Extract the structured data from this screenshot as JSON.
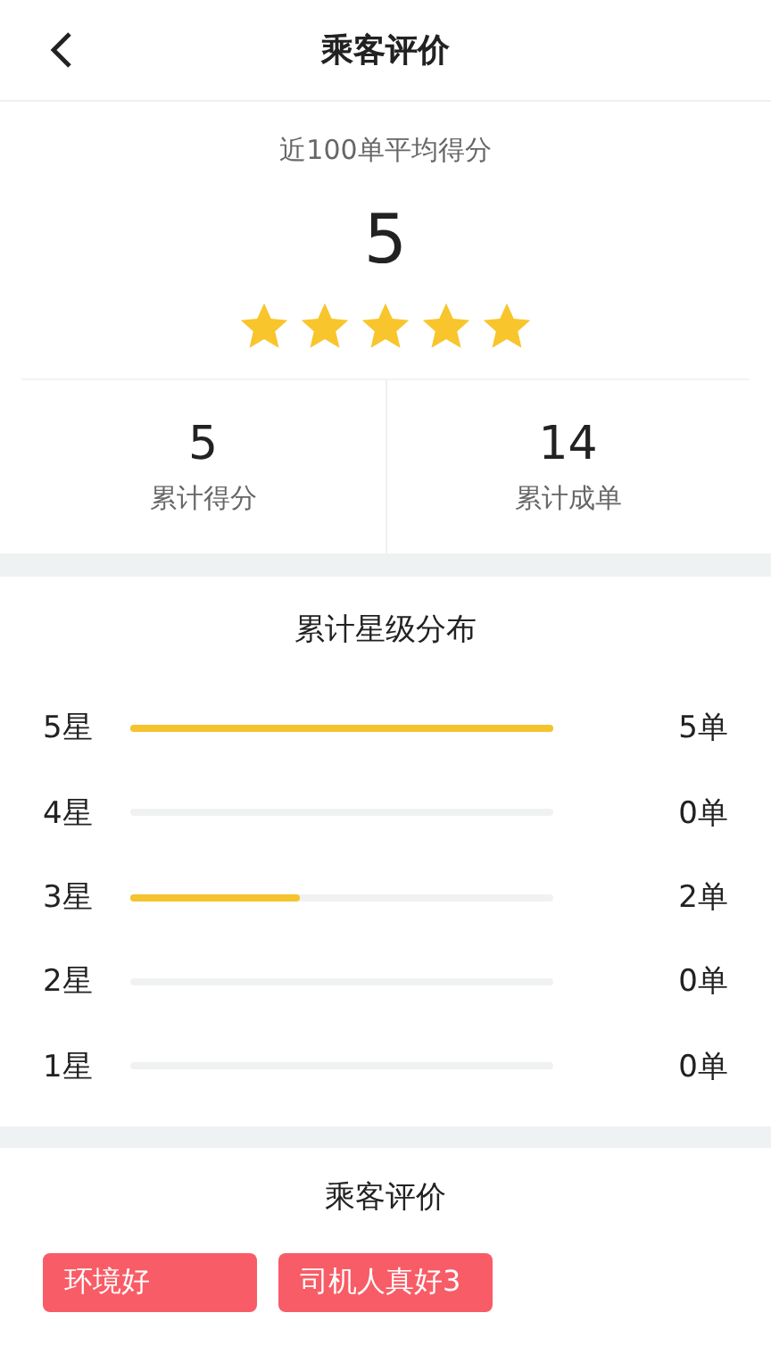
{
  "header": {
    "title": "乘客评价"
  },
  "summary": {
    "caption": "近100单平均得分",
    "score": "5",
    "stars": 5,
    "stats": [
      {
        "value": "5",
        "label": "累计得分"
      },
      {
        "value": "14",
        "label": "累计成单"
      }
    ]
  },
  "distribution": {
    "title": "累计星级分布",
    "rows": [
      {
        "label": "5星",
        "level": 1,
        "count": "5单"
      },
      {
        "label": "4星",
        "level": 0,
        "count": "0单"
      },
      {
        "label": "3星",
        "level": 0.4,
        "count": "2单"
      },
      {
        "label": "2星",
        "level": 0,
        "count": "0单"
      },
      {
        "label": "1星",
        "level": 0,
        "count": "0单"
      }
    ]
  },
  "comments": {
    "title": "乘客评价",
    "tags": [
      "环境好",
      "司机人真好3"
    ]
  }
}
